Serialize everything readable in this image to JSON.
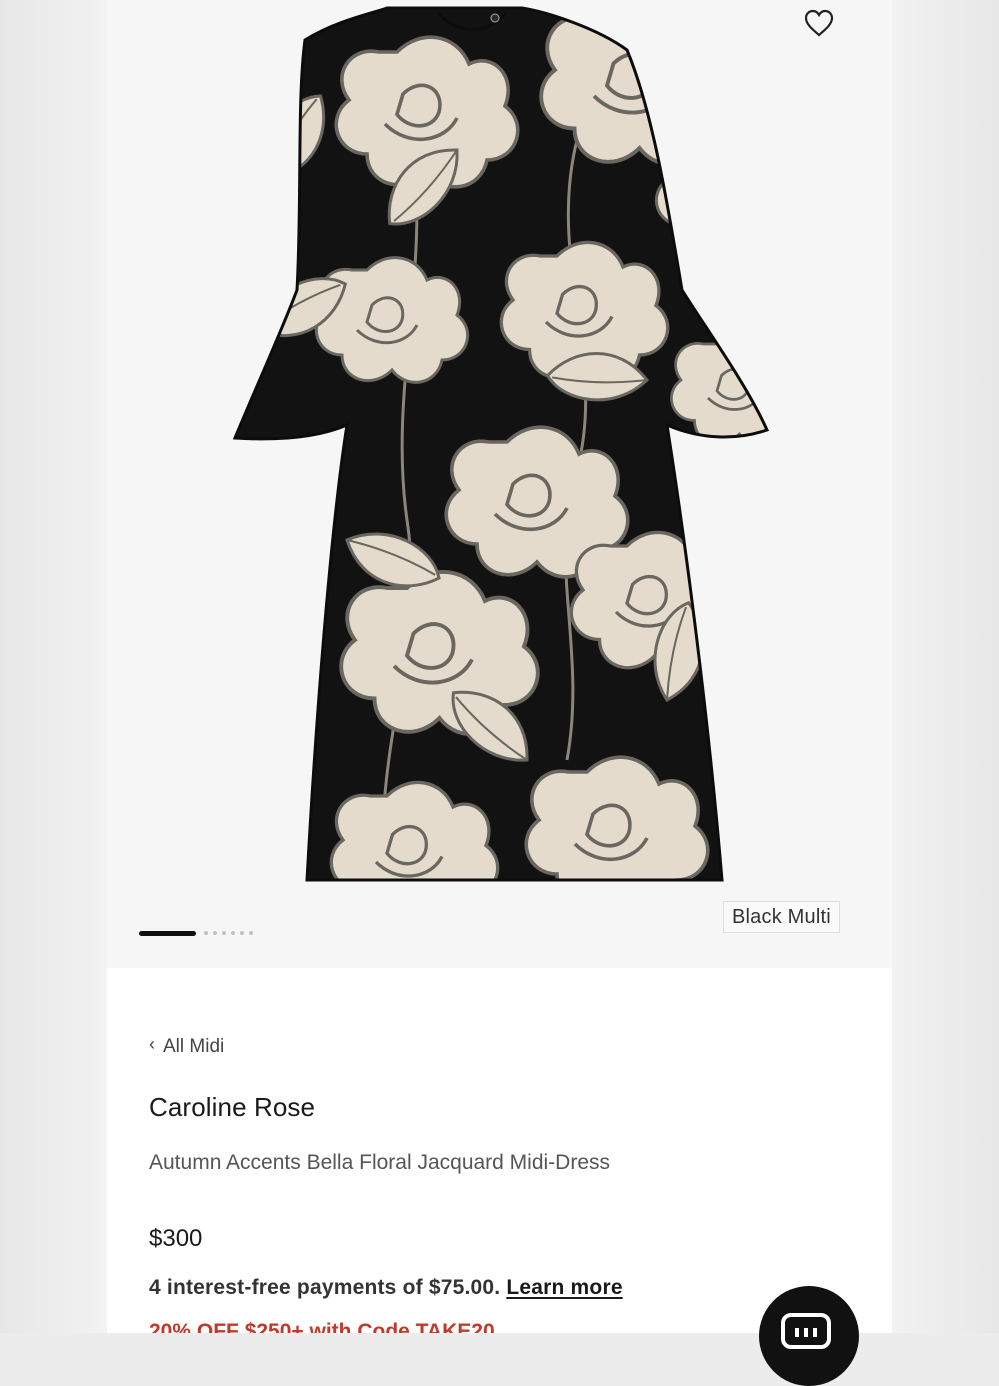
{
  "product": {
    "color_label": "Black Multi",
    "breadcrumb_label": "All Midi",
    "brand": "Caroline Rose",
    "name": "Autumn Accents Bella Floral Jacquard Midi-Dress",
    "price": "$300",
    "installments_text": "4 interest-free payments of $75.00.",
    "learn_more_label": "Learn more",
    "promo_text": "20% OFF $250+ with Code TAKE20"
  },
  "gallery": {
    "image_count": 7,
    "active_index": 0
  },
  "icons": {
    "wishlist": "heart-icon",
    "back": "chevron-left-icon",
    "chat": "chat-icon"
  },
  "colors": {
    "dress_black": "#121212",
    "pattern_cream": "#e6ddcf",
    "promo_red": "#c0392b"
  }
}
